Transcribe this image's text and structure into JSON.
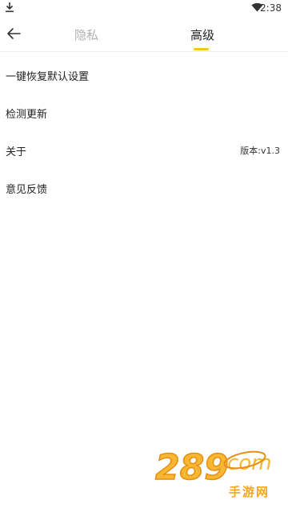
{
  "status": {
    "time": "2:38"
  },
  "header": {
    "tabs": [
      {
        "label": "隐私",
        "active": false
      },
      {
        "label": "高级",
        "active": true
      }
    ],
    "accent_color": "#f5c518"
  },
  "settings": [
    {
      "label": "一键恢复默认设置"
    },
    {
      "label": "检测更新"
    },
    {
      "label": "关于",
      "value": "版本:v1.3"
    },
    {
      "label": "意见反馈"
    }
  ],
  "watermark": {
    "text": "手游网"
  }
}
